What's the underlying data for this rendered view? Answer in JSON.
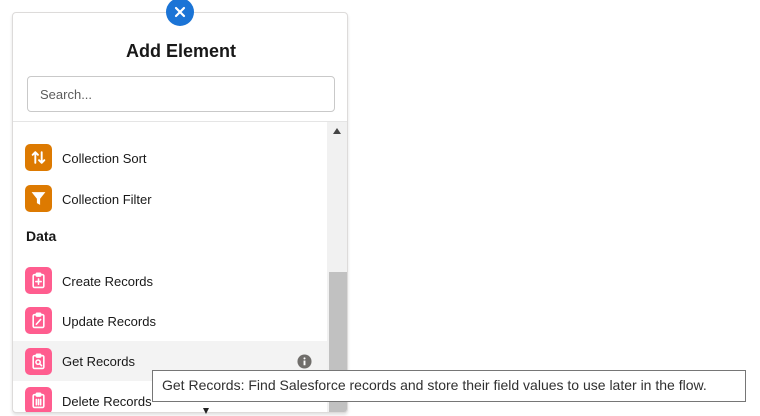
{
  "panel": {
    "title": "Add Element",
    "close_icon": "close-icon",
    "search": {
      "placeholder": "Search...",
      "value": ""
    }
  },
  "list": {
    "items": [
      {
        "label": "Collection Sort",
        "icon": "sort-arrows-icon",
        "color": "#dd7a01"
      },
      {
        "label": "Collection Filter",
        "icon": "funnel-icon",
        "color": "#dd7a01"
      }
    ],
    "section": {
      "label": "Data"
    },
    "data_items": [
      {
        "label": "Create Records",
        "icon": "create-records-icon",
        "color": "#ff5d8f"
      },
      {
        "label": "Update Records",
        "icon": "update-records-icon",
        "color": "#ff5d8f"
      },
      {
        "label": "Get Records",
        "icon": "get-records-icon",
        "color": "#ff5d8f",
        "hovered": true,
        "info_icon": "info-icon"
      },
      {
        "label": "Delete Records",
        "icon": "delete-records-icon",
        "color": "#ff5d8f"
      }
    ]
  },
  "tooltip": {
    "text": "Get Records: Find Salesforce records and store their field values to use later in the flow."
  },
  "colors": {
    "accent": "#1b74d6",
    "orange": "#dd7a01",
    "pink": "#ff5d8f"
  }
}
